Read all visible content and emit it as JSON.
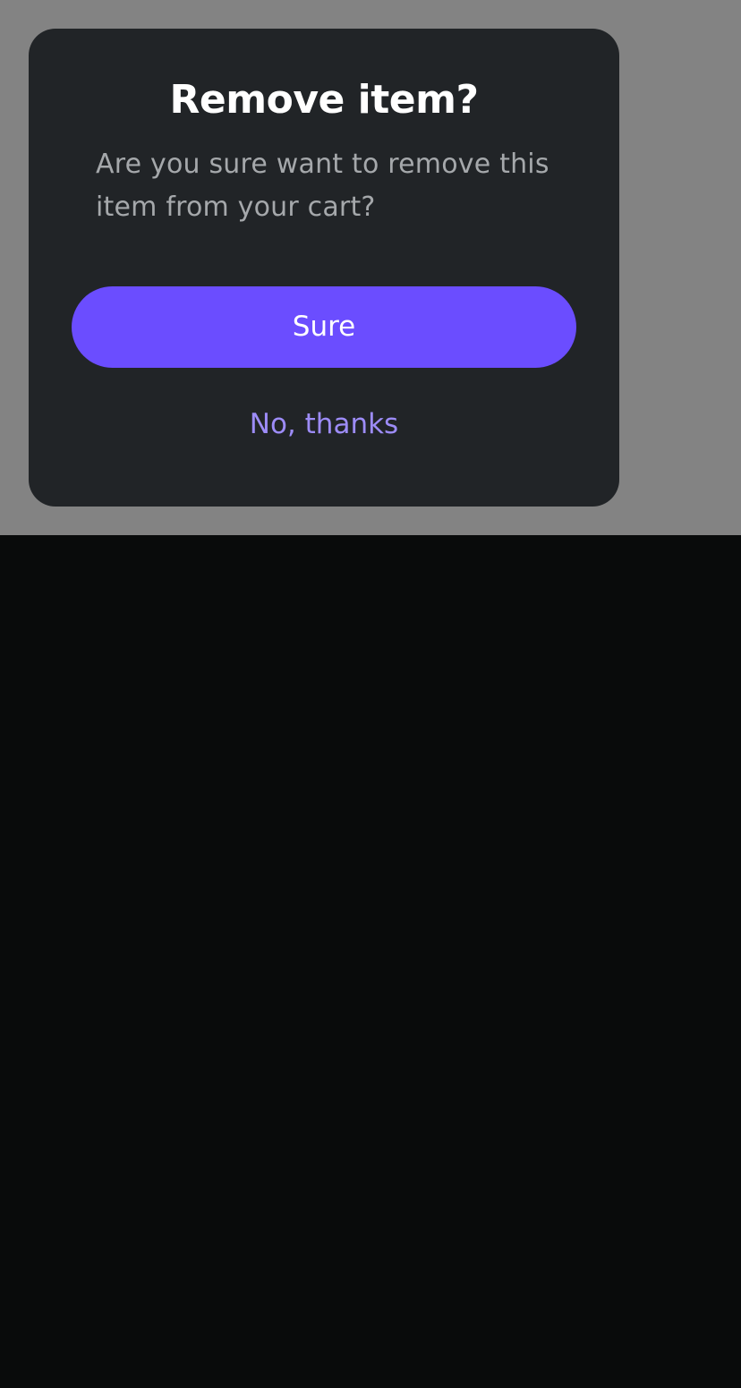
{
  "dialog": {
    "title": "Remove item?",
    "message": "Are you sure want to remove this item from your cart?",
    "confirm_label": "Sure",
    "cancel_label": "No, thanks"
  },
  "colors": {
    "backdrop": "#838383",
    "dialog_background": "#212427",
    "screen_background": "#090b0b",
    "primary_button": "#6b4dff",
    "cancel_link": "#9d8cf8",
    "title_text": "#ffffff",
    "message_text": "#a5a8ab"
  }
}
